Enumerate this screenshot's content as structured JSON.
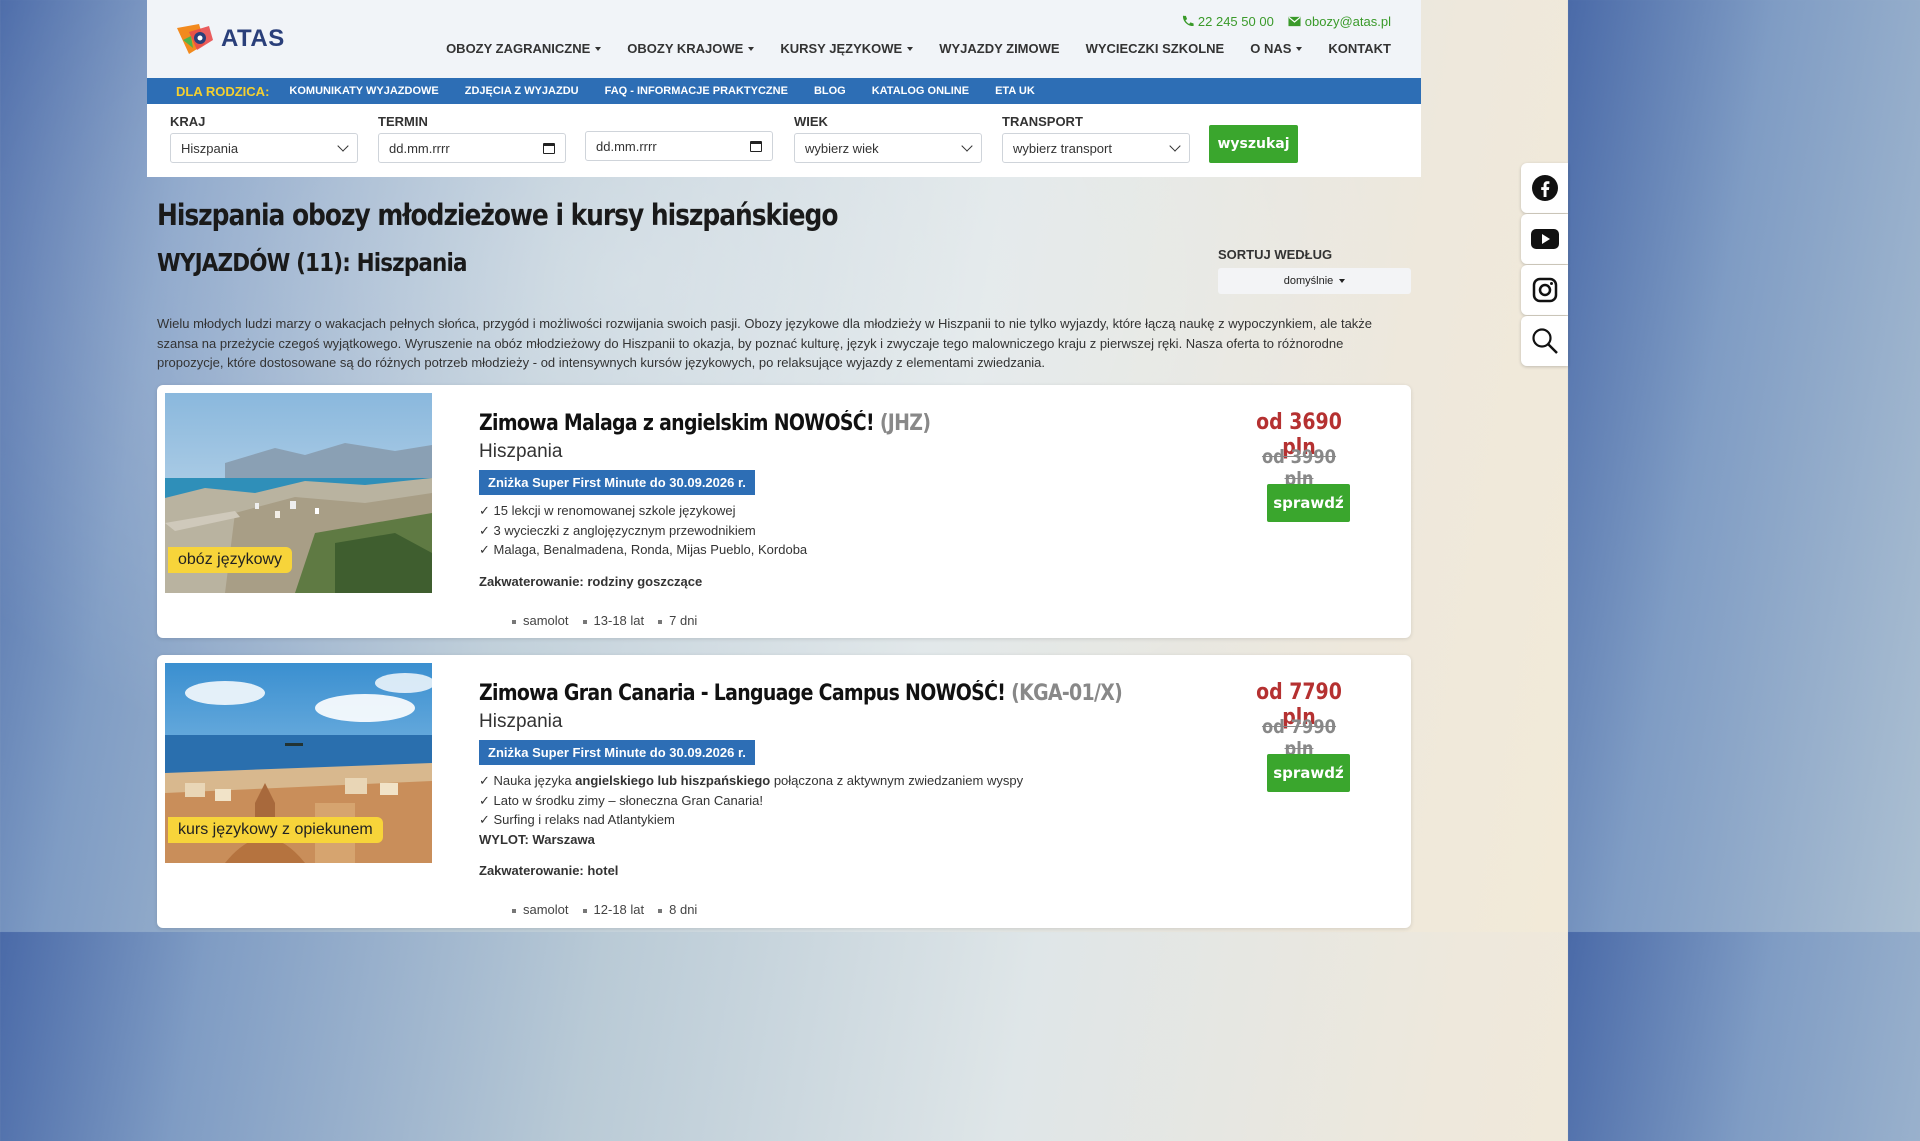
{
  "header": {
    "brand": "ATAS",
    "phone": "22 245 50 00",
    "email": "obozy@atas.pl",
    "nav": [
      {
        "label": "OBOZY ZAGRANICZNE",
        "dropdown": true
      },
      {
        "label": "OBOZY KRAJOWE",
        "dropdown": true
      },
      {
        "label": "KURSY JĘZYKOWE",
        "dropdown": true
      },
      {
        "label": "WYJAZDY ZIMOWE",
        "dropdown": false
      },
      {
        "label": "WYCIECZKI SZKOLNE",
        "dropdown": false
      },
      {
        "label": "O NAS",
        "dropdown": true
      },
      {
        "label": "KONTAKT",
        "dropdown": false
      }
    ]
  },
  "subnav": {
    "lead": "DLA RODZICA:",
    "items": [
      "KOMUNIKATY WYJAZDOWE",
      "ZDJĘCIA Z WYJAZDU",
      "FAQ - INFORMACJE PRAKTYCZNE",
      "BLOG",
      "KATALOG ONLINE",
      "ETA UK"
    ]
  },
  "search": {
    "country_label": "KRAJ",
    "country_value": "Hiszpania",
    "term_label": "TERMIN",
    "date_from": "dd.mm.rrrr",
    "date_to": "dd.mm.rrrr",
    "age_label": "WIEK",
    "age_value": "wybierz wiek",
    "transport_label": "TRANSPORT",
    "transport_value": "wybierz transport",
    "submit": "wyszukaj"
  },
  "page": {
    "title": "Hiszpania obozy młodzieżowe i kursy hiszpańskiego",
    "subtitle": "WYJAZDÓW (11): Hiszpania",
    "sort_label": "SORTUJ WEDŁUG",
    "sort_value": "domyślnie",
    "intro": "Wielu młodych ludzi marzy o wakacjach pełnych słońca, przygód i możliwości rozwijania swoich pasji. Obozy językowe dla młodzieży w Hiszpanii to nie tylko wyjazdy, które łączą naukę z wypoczynkiem, ale także szansa na przeżycie czegoś wyjątkowego. Wyruszenie na obóz młodzieżowy do Hiszpanii to okazja, by poznać kulturę, język i zwyczaje tego malowniczego kraju z pierwszej ręki. Nasza oferta to różnorodne propozycje, które dostosowane są do różnych potrzeb młodzieży - od intensywnych kursów językowych, po relaksujące wyjazdy z elementami zwiedzania."
  },
  "offers": [
    {
      "title": "Zimowa Malaga z angielskim NOWOŚĆ!",
      "code": "(JHZ)",
      "country": "Hiszpania",
      "tag": "obóz językowy",
      "promo": "Zniżka Super First Minute do 30.09.2026 r.",
      "bullets": [
        "✓ 15 lekcji w renomowanej szkole językowej",
        "✓ 3 wycieczki z anglojęzycznym przewodnikiem",
        "✓ Malaga, Benalmadena, Ronda, Mijas Pueblo, Kordoba"
      ],
      "accommodation": "Zakwaterowanie: rodziny goszczące",
      "transport": "samolot",
      "age": "13-18 lat",
      "duration": "7 dni",
      "price": "od 3690 pln",
      "old_price": "od 3990 pln",
      "cta": "sprawdź"
    },
    {
      "title": "Zimowa Gran Canaria - Language Campus NOWOŚĆ!",
      "code": "(KGA-01/X)",
      "country": "Hiszpania",
      "tag": "kurs językowy z opiekunem",
      "promo": "Zniżka Super First Minute do 30.09.2026 r.",
      "bullet1_pre": "✓ Nauka języka ",
      "bullet1_bold": "angielskiego lub hiszpańskiego",
      "bullet1_post": " połączona z aktywnym zwiedzaniem wyspy",
      "bullets": [
        "✓ Lato w środku zimy – słoneczna Gran Canaria!",
        "✓ Surfing i relaks nad Atlantykiem"
      ],
      "departure": "WYLOT: Warszawa",
      "accommodation": "Zakwaterowanie: hotel",
      "transport": "samolot",
      "age": "12-18 lat",
      "duration": "8 dni",
      "price": "od 7790 pln",
      "old_price": "od 7990 pln",
      "cta": "sprawdź"
    }
  ],
  "social": [
    "facebook-icon",
    "youtube-icon",
    "instagram-icon",
    "search-icon"
  ],
  "colors": {
    "brand_blue": "#2d6eb5",
    "green": "#3aa62d",
    "price_red": "#b53131",
    "tag_yellow": "#f7d43a"
  }
}
